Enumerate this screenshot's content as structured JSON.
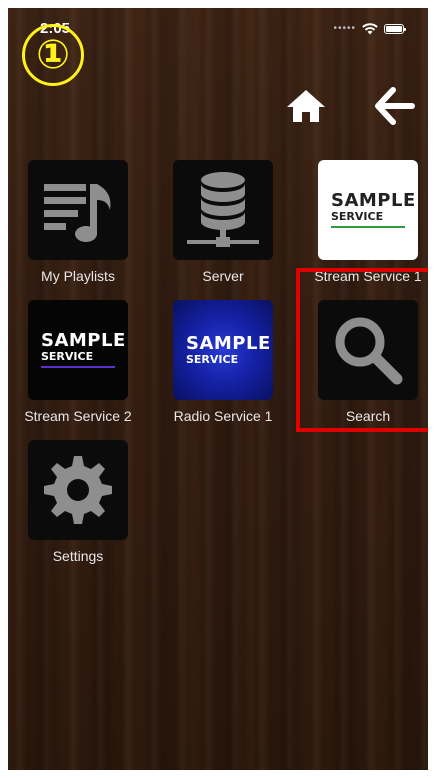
{
  "status_bar": {
    "time": "2:05"
  },
  "annotation": {
    "marker": "①",
    "highlight_color": "#e00000",
    "marker_color": "#fff21a"
  },
  "nav": {
    "home_icon": "home-icon",
    "back_icon": "arrow-left-icon"
  },
  "tiles": [
    {
      "label": "My Playlists",
      "icon": "playlist-music-icon"
    },
    {
      "label": "Server",
      "icon": "database-server-icon"
    },
    {
      "label": "Stream Service 1",
      "icon": "sample-service-logo",
      "logo_big": "SAMPLE",
      "logo_small": "SERVICE",
      "logo_rule_color": "#2e9a3e"
    },
    {
      "label": "Stream Service 2",
      "icon": "sample-service-logo",
      "logo_big": "SAMPLE",
      "logo_small": "SERVICE",
      "logo_rule_color": "#5a2ec9"
    },
    {
      "label": "Radio Service 1",
      "icon": "sample-service-logo",
      "logo_big": "SAMPLE",
      "logo_small": "SERVICE"
    },
    {
      "label": "Search",
      "icon": "search-icon"
    },
    {
      "label": "Settings",
      "icon": "gear-icon"
    }
  ]
}
